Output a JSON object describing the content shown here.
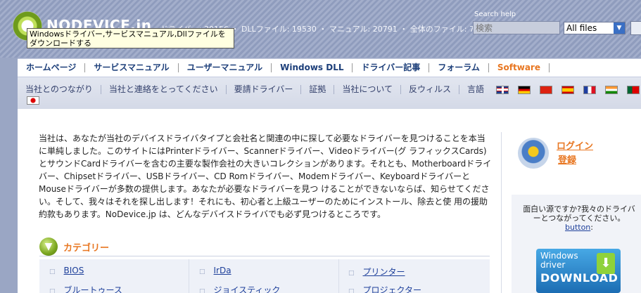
{
  "header": {
    "brand": "NODEVICE.in",
    "stats": "ドライバー: 30156 ・ DLLファイル: 19530 ・ マニュアル: 20791 ・ 全体のファイル: 70477",
    "tooltip": "Windowsドライバー,サービスマニュアル,Dllファイルをダウンロードする",
    "search_label": "Search help",
    "search_placeholder": "検索",
    "select_value": "All files"
  },
  "main_nav": [
    "ホームページ",
    "サービスマニュアル",
    "ユーザーマニュアル",
    "Windows DLL",
    "ドライバー記事",
    "フォーラム",
    "Software"
  ],
  "sub_nav": [
    "当社とのつながり",
    "当社と連絡をとってください",
    "要請ドライバー",
    "証拠",
    "当社について",
    "反ウィルス",
    "言語"
  ],
  "intro": "当社は、あなたが当社のデバイスドライバタイプと会社名と関連の中に探して必要なドライバーを見つけることを本当に単純しました。このサイトにはPrinterドライバー、Scannerドライバー、Videoドライバー(グ ラフィックスCards)とサウンドCardドライバーを含むの主要な製作会社の大きいコレクションがあります。それとも、Motherboardドライバー、Chipsetドライバー、USBドライバー、CD Romドライバー、Modemドライバー、KeyboardドライバーとMouseドライバーが多数の提供します。あなたが必要なドライバーを見つ けることができないならば、知らせてください。そして、我々はそれを探し出します！それにも、初心者と上級ユーザーのためにインストール、除去と使 用の援助約款もあります。NoDevice.jp は、どんなデバイスドライバでも必ず見つけるところです。",
  "categories": {
    "title": "カテゴリー",
    "items": [
      "BIOS",
      "IrDa",
      "プリンター",
      "ブルートゥース",
      "ジョイスティック",
      "プロジェクター"
    ]
  },
  "sidebar": {
    "login": "ログイン",
    "register": "登録",
    "promo_text": "面白い源ですか?我々のドライバーとつながってください。",
    "promo_link": "button",
    "promo_colon": ":",
    "download_line1": "Windows",
    "download_line2": "driver",
    "download_line3": "DOWNLOAD"
  },
  "colors": {
    "accent": "#e87722",
    "link": "#1d3f9a",
    "nav": "#1d3f7a"
  }
}
